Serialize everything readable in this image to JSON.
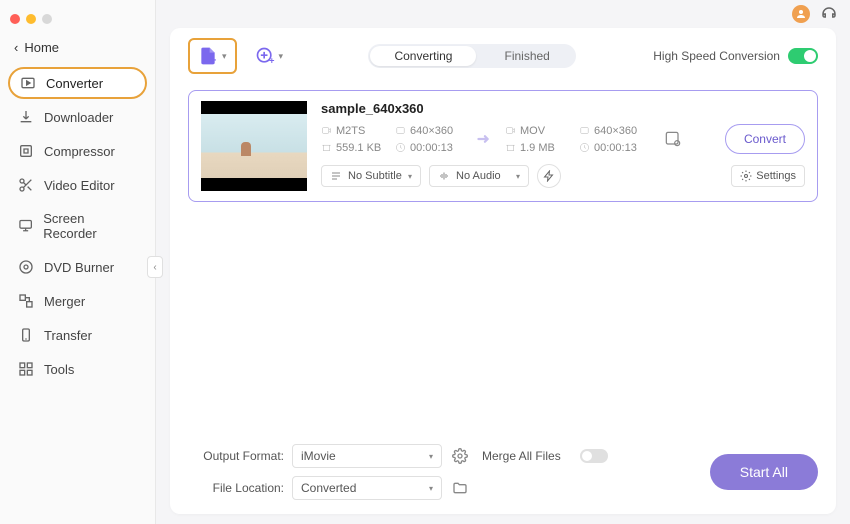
{
  "home_label": "Home",
  "sidebar": {
    "items": [
      {
        "label": "Converter"
      },
      {
        "label": "Downloader"
      },
      {
        "label": "Compressor"
      },
      {
        "label": "Video Editor"
      },
      {
        "label": "Screen Recorder"
      },
      {
        "label": "DVD Burner"
      },
      {
        "label": "Merger"
      },
      {
        "label": "Transfer"
      },
      {
        "label": "Tools"
      }
    ]
  },
  "tabs": {
    "converting": "Converting",
    "finished": "Finished"
  },
  "hsc_label": "High Speed Conversion",
  "file": {
    "name": "sample_640x360",
    "src_format": "M2TS",
    "src_res": "640×360",
    "src_size": "559.1 KB",
    "src_dur": "00:00:13",
    "dst_format": "MOV",
    "dst_res": "640×360",
    "dst_size": "1.9 MB",
    "dst_dur": "00:00:13",
    "subtitle": "No Subtitle",
    "audio": "No Audio",
    "settings_label": "Settings",
    "convert_label": "Convert"
  },
  "footer": {
    "output_format_label": "Output Format:",
    "output_format_value": "iMovie",
    "file_location_label": "File Location:",
    "file_location_value": "Converted",
    "merge_label": "Merge All Files",
    "start_all_label": "Start All"
  }
}
